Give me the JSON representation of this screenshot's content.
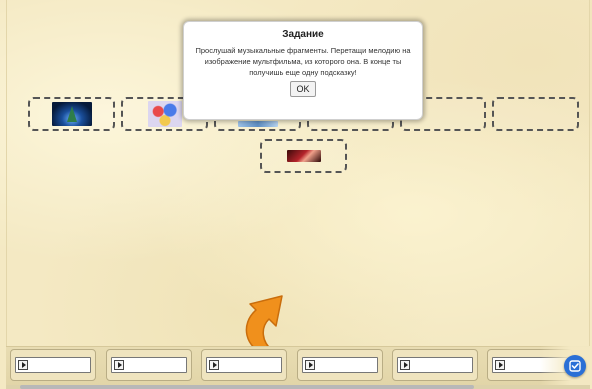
{
  "dialog": {
    "title": "Задание",
    "text": "Прослушай музыкальные фрагменты. Перетащи мелодию на изображение мультфильма, из которого она. В конце ты получишь еще одну подсказку!",
    "ok_label": "OK"
  },
  "drop_zones": [
    {
      "name": "drop-zone-1",
      "image": "christmas-tree-cartoon-image"
    },
    {
      "name": "drop-zone-2",
      "image": "toys-cartoon-image"
    },
    {
      "name": "drop-zone-3",
      "image": "winter-blue-cartoon-image"
    },
    {
      "name": "drop-zone-4",
      "image": "empty"
    },
    {
      "name": "drop-zone-5",
      "image": "empty"
    },
    {
      "name": "drop-zone-6",
      "image": "empty"
    },
    {
      "name": "drop-zone-7",
      "image": "red-cartoon-image"
    }
  ],
  "audio_items": [
    {
      "name": "audio-fragment-1",
      "icon": "play-icon"
    },
    {
      "name": "audio-fragment-2",
      "icon": "play-icon"
    },
    {
      "name": "audio-fragment-3",
      "icon": "play-icon"
    },
    {
      "name": "audio-fragment-4",
      "icon": "play-icon"
    },
    {
      "name": "audio-fragment-5",
      "icon": "play-icon"
    },
    {
      "name": "audio-fragment-6",
      "icon": "play-icon"
    }
  ],
  "hint_arrow": {
    "icon": "curved-arrow-icon",
    "color": "#f0901c"
  },
  "check_button": {
    "icon": "check-icon",
    "color": "#2a6fd6"
  },
  "colors": {
    "background": "#f4e9c3",
    "drop_zone_border": "#555555",
    "accent": "#2a6fd6"
  }
}
